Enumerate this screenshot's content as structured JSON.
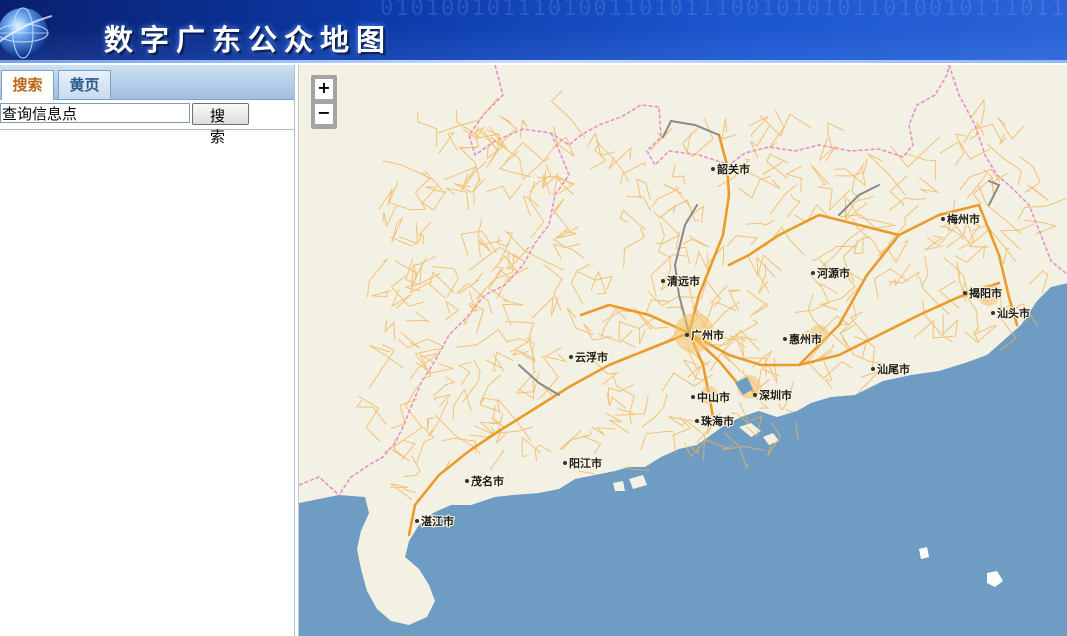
{
  "header": {
    "title": "数字广东公众地图",
    "logo_icon": "globe-icon",
    "binary_decoration": "0101001011101001101011100101010110100101110110100101011"
  },
  "sidebar": {
    "tabs": [
      {
        "label": "搜索",
        "active": true
      },
      {
        "label": "黄页",
        "active": false
      }
    ],
    "search": {
      "input_value": "查询信息点",
      "button_label": "搜 索"
    }
  },
  "map": {
    "zoom_in_label": "+",
    "zoom_out_label": "−",
    "colors": {
      "land": "#f3f0e4",
      "sea": "#6f9cc3",
      "roads": "#f3b351",
      "highways": "#8a8a8a",
      "border": "#e890c8"
    },
    "cities": [
      {
        "name": "韶关市"
      },
      {
        "name": "梅州市"
      },
      {
        "name": "清远市"
      },
      {
        "name": "河源市"
      },
      {
        "name": "揭阳市"
      },
      {
        "name": "汕头市"
      },
      {
        "name": "广州市"
      },
      {
        "name": "惠州市"
      },
      {
        "name": "云浮市"
      },
      {
        "name": "汕尾市"
      },
      {
        "name": "中山市"
      },
      {
        "name": "深圳市"
      },
      {
        "name": "珠海市"
      },
      {
        "name": "阳江市"
      },
      {
        "name": "茂名市"
      },
      {
        "name": "湛江市"
      }
    ]
  }
}
